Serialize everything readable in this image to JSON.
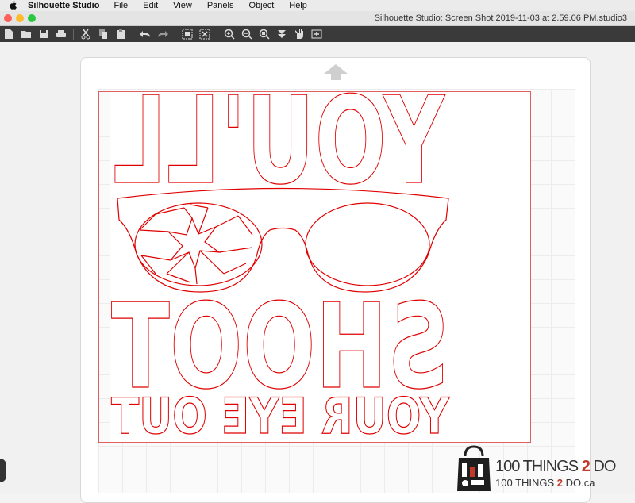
{
  "menubar": {
    "app_name": "Silhouette Studio",
    "items": [
      "File",
      "Edit",
      "View",
      "Panels",
      "Object",
      "Help"
    ]
  },
  "window": {
    "title": "Silhouette Studio: Screen Shot 2019-11-03 at 2.59.06 PM.studio3"
  },
  "toolbar": {
    "icons": [
      "new-document-icon",
      "open-folder-icon",
      "save-icon",
      "print-icon",
      "cut-icon",
      "copy-icon",
      "paste-icon",
      "undo-icon",
      "redo-icon",
      "select-all-icon",
      "deselect-icon",
      "zoom-in-icon",
      "zoom-out-icon",
      "zoom-fit-icon",
      "move-down-icon",
      "pan-hand-icon",
      "add-page-icon"
    ]
  },
  "design": {
    "line1": "YOU'LL",
    "line2": "SHOOT",
    "line3": "YOUR EYE OUT",
    "mirrored": true,
    "cut_line_color": "#e00000"
  },
  "watermark": {
    "line1_pre": "100 THINGS ",
    "line1_two": "2",
    "line1_post": " DO",
    "line2_pre": "100 THINGS ",
    "line2_two": "2",
    "line2_post": " DO.ca"
  }
}
